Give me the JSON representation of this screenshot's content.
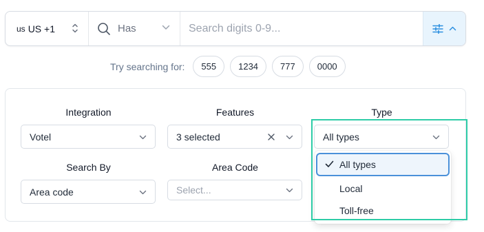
{
  "search": {
    "country_flag": "us",
    "country_code": "US +1",
    "match_type": "Has",
    "digits_placeholder": "Search digits 0-9..."
  },
  "suggestions": {
    "label": "Try searching for:",
    "chips": [
      "555",
      "1234",
      "777",
      "0000"
    ]
  },
  "filters": {
    "integration": {
      "label": "Integration",
      "value": "Votel"
    },
    "features": {
      "label": "Features",
      "value": "3 selected"
    },
    "type": {
      "label": "Type",
      "value": "All types",
      "options": [
        "All types",
        "Local",
        "Toll-free"
      ],
      "selected_index": 0
    },
    "search_by": {
      "label": "Search By",
      "value": "Area code"
    },
    "area_code": {
      "label": "Area Code",
      "placeholder": "Select..."
    }
  },
  "colors": {
    "accent": "#2c8fe0",
    "highlight": "#2dcca7",
    "filter_button_bg": "#e8f4fd"
  }
}
